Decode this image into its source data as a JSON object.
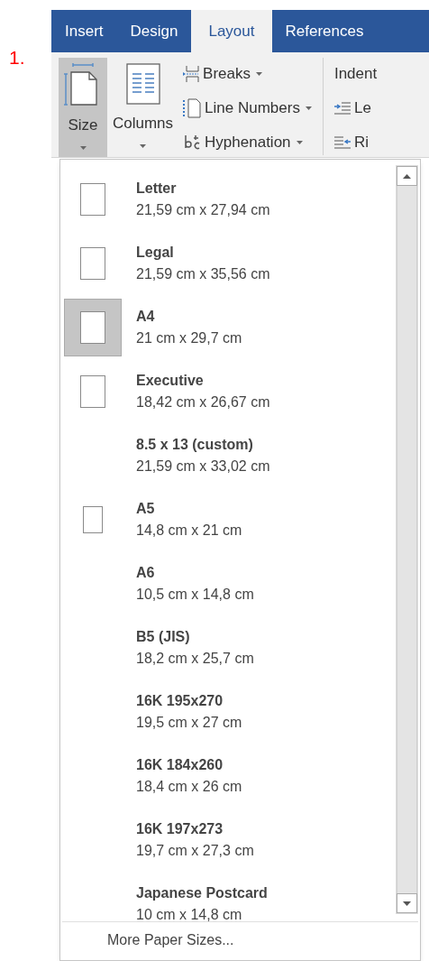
{
  "step_label": "1.",
  "tabs": [
    {
      "label": "Insert",
      "selected": false
    },
    {
      "label": "Design",
      "selected": false
    },
    {
      "label": "Layout",
      "selected": true
    },
    {
      "label": "References",
      "selected": false
    }
  ],
  "ribbon": {
    "large_buttons": [
      {
        "label": "Size",
        "selected": true,
        "kind": "size"
      },
      {
        "label": "Columns",
        "selected": false,
        "kind": "columns"
      }
    ],
    "small_buttons": [
      {
        "label": "Breaks",
        "kind": "breaks"
      },
      {
        "label": "Line Numbers",
        "kind": "line-numbers"
      },
      {
        "label": "Hyphenation",
        "kind": "hyphenation"
      }
    ],
    "indent_group": {
      "title": "Indent",
      "items": [
        {
          "label": "Le",
          "kind": "left"
        },
        {
          "label": "Ri",
          "kind": "right"
        }
      ]
    }
  },
  "paper_sizes": [
    {
      "name": "Letter",
      "dimensions": "21,59 cm x 27,94 cm",
      "kind": "page",
      "selected": false
    },
    {
      "name": "Legal",
      "dimensions": "21,59 cm x 35,56 cm",
      "kind": "page",
      "selected": false
    },
    {
      "name": "A4",
      "dimensions": "21 cm x 29,7 cm",
      "kind": "page",
      "selected": true
    },
    {
      "name": "Executive",
      "dimensions": "18,42 cm x 26,67 cm",
      "kind": "page",
      "selected": false
    },
    {
      "name": "8.5 x 13 (custom)",
      "dimensions": "21,59 cm x 33,02 cm",
      "kind": "plain",
      "selected": false
    },
    {
      "name": "A5",
      "dimensions": "14,8 cm x 21 cm",
      "kind": "small-page",
      "selected": false
    },
    {
      "name": "A6",
      "dimensions": "10,5 cm x 14,8 cm",
      "kind": "plain",
      "selected": false
    },
    {
      "name": "B5 (JIS)",
      "dimensions": "18,2 cm x 25,7 cm",
      "kind": "plain",
      "selected": false
    },
    {
      "name": "16K 195x270",
      "dimensions": "19,5 cm x 27 cm",
      "kind": "plain",
      "selected": false
    },
    {
      "name": "16K 184x260",
      "dimensions": "18,4 cm x 26 cm",
      "kind": "plain",
      "selected": false
    },
    {
      "name": "16K 197x273",
      "dimensions": "19,7 cm x 27,3 cm",
      "kind": "plain",
      "selected": false
    },
    {
      "name": "Japanese Postcard",
      "dimensions": "10 cm x 14,8 cm",
      "kind": "plain",
      "selected": false
    }
  ],
  "more_link": "More Paper Sizes..."
}
